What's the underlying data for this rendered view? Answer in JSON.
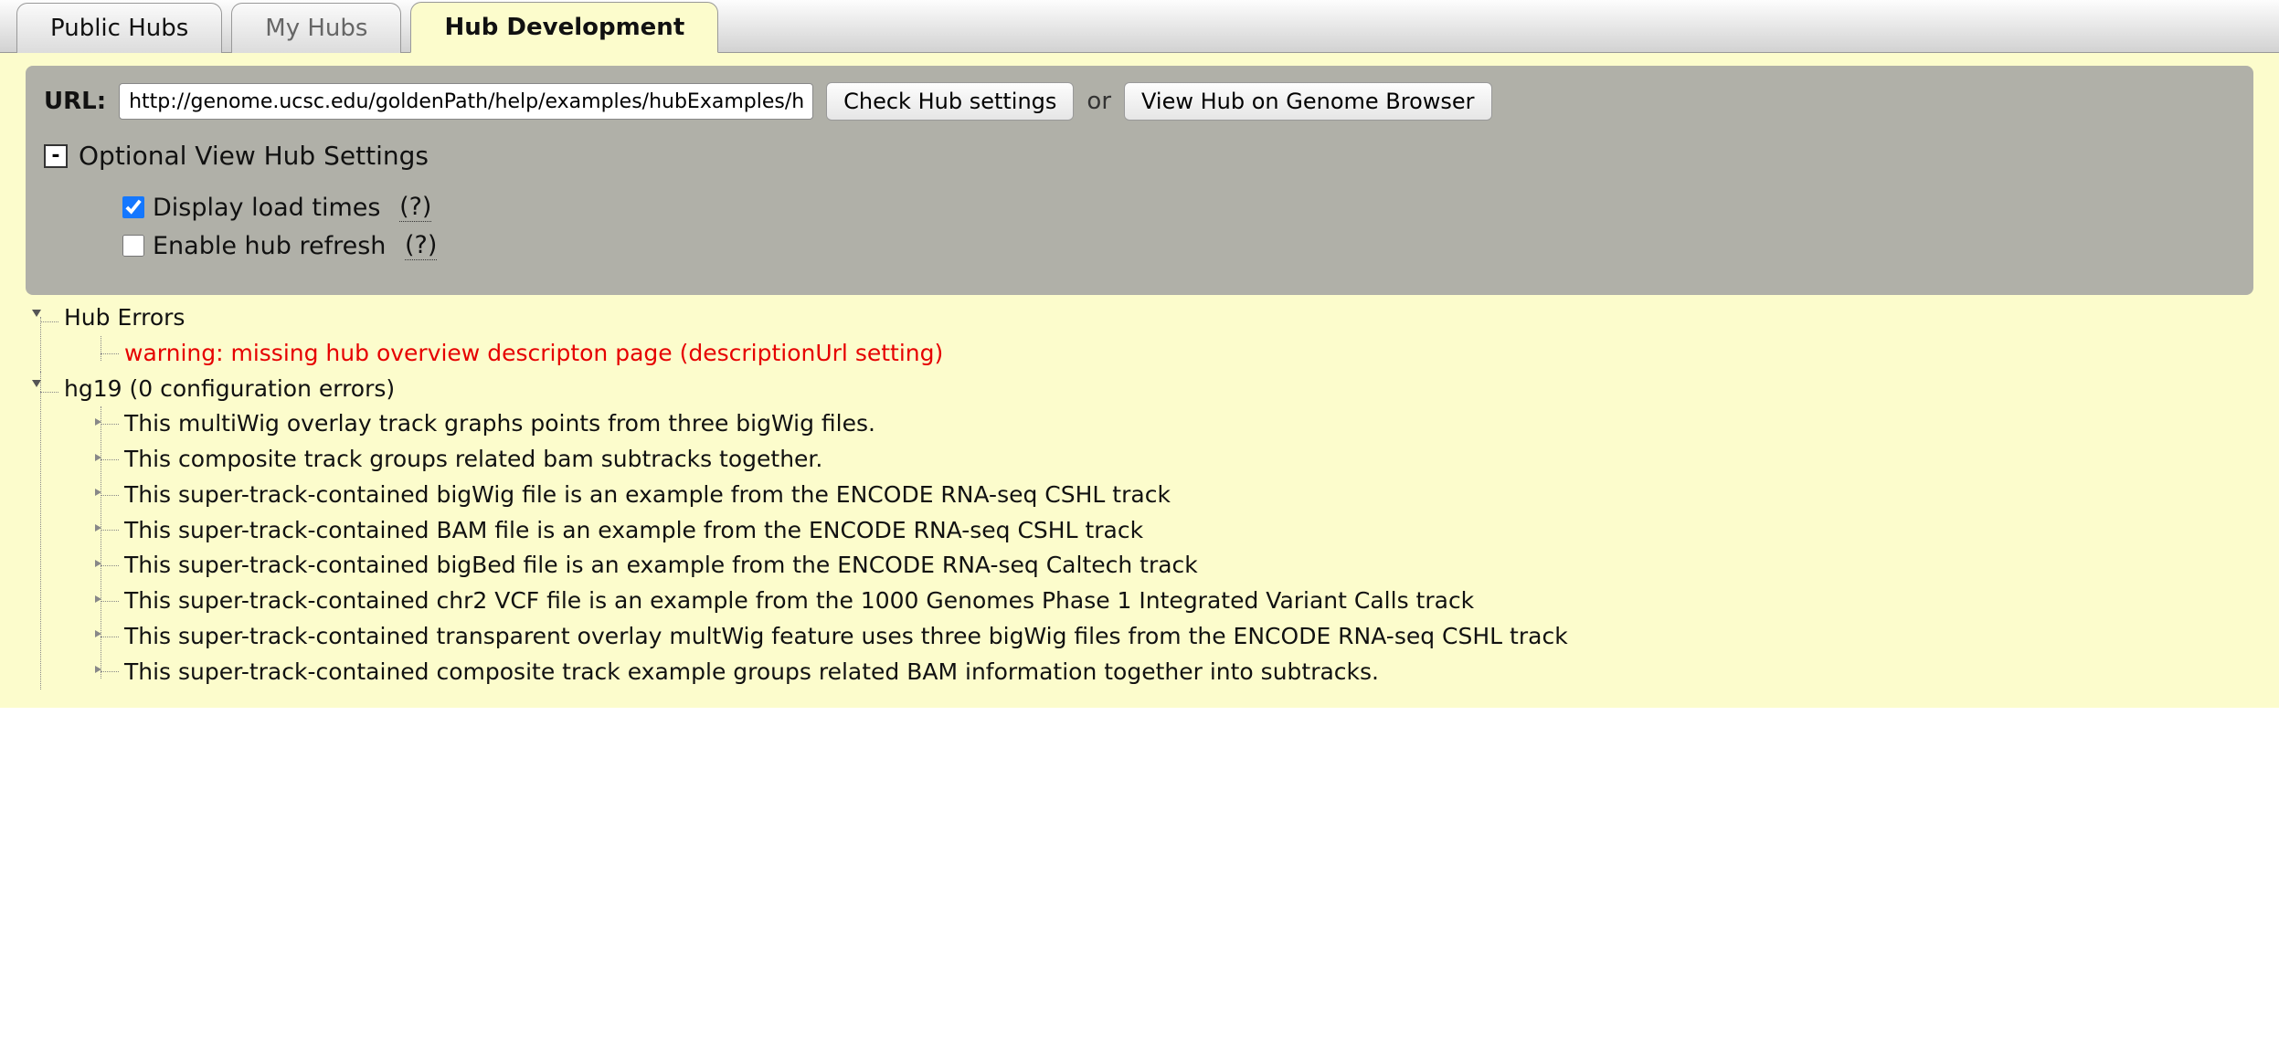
{
  "tabs": {
    "public": "Public Hubs",
    "my": "My Hubs",
    "dev": "Hub Development"
  },
  "settings": {
    "url_label": "URL:",
    "url_value": "http://genome.ucsc.edu/goldenPath/help/examples/hubExamples/hubGro",
    "check_btn": "Check Hub settings",
    "or": "or",
    "view_btn": "View Hub on Genome Browser",
    "expander_symbol": "-",
    "expander_title": "Optional View Hub Settings",
    "opt_load_times": "Display load times",
    "opt_refresh": "Enable hub refresh",
    "help_q": "(?)"
  },
  "tree": {
    "hub_errors": {
      "label": "Hub Errors",
      "warning": "warning: missing hub overview descripton page (descriptionUrl setting)"
    },
    "genome": {
      "label": "hg19 (0 configuration errors)",
      "tracks": [
        "This multiWig overlay track graphs points from three bigWig files.",
        "This composite track groups related bam subtracks together.",
        "This super-track-contained bigWig file is an example from the ENCODE RNA-seq CSHL track",
        "This super-track-contained BAM file is an example from the ENCODE RNA-seq CSHL track",
        "This super-track-contained bigBed file is an example from the ENCODE RNA-seq Caltech track",
        "This super-track-contained chr2 VCF file is an example from the 1000 Genomes Phase 1 Integrated Variant Calls track",
        "This super-track-contained transparent overlay multWig feature uses three bigWig files from the ENCODE RNA-seq CSHL track",
        "This super-track-contained composite track example groups related BAM information together into subtracks."
      ]
    }
  }
}
